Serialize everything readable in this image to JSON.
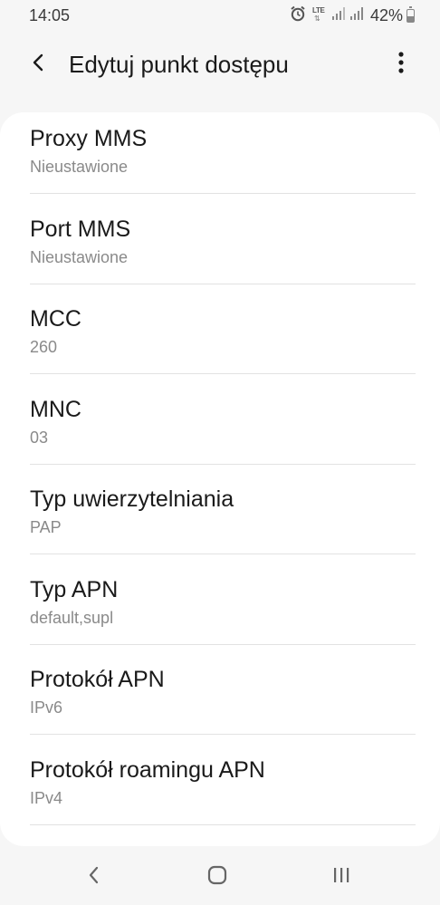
{
  "status_bar": {
    "time": "14:05",
    "network": "LTE",
    "battery_percent": "42%",
    "battery_level": 0.42,
    "icons": [
      "alarm-icon",
      "lte-icon",
      "signal-icon",
      "signal-icon",
      "battery-icon"
    ]
  },
  "header": {
    "title": "Edytuj punkt dostępu",
    "back_icon": "back-arrow-icon",
    "more_icon": "more-vertical-icon"
  },
  "settings": [
    {
      "title": "Proxy MMS",
      "value": "Nieustawione"
    },
    {
      "title": "Port MMS",
      "value": "Nieustawione"
    },
    {
      "title": "MCC",
      "value": "260"
    },
    {
      "title": "MNC",
      "value": "03"
    },
    {
      "title": "Typ uwierzytelniania",
      "value": "PAP"
    },
    {
      "title": "Typ APN",
      "value": "default,supl"
    },
    {
      "title": "Protokół APN",
      "value": "IPv6"
    },
    {
      "title": "Protokół roamingu APN",
      "value": "IPv4"
    }
  ],
  "nav_bar": {
    "icons": [
      "nav-back-icon",
      "nav-home-icon",
      "nav-recents-icon"
    ]
  }
}
